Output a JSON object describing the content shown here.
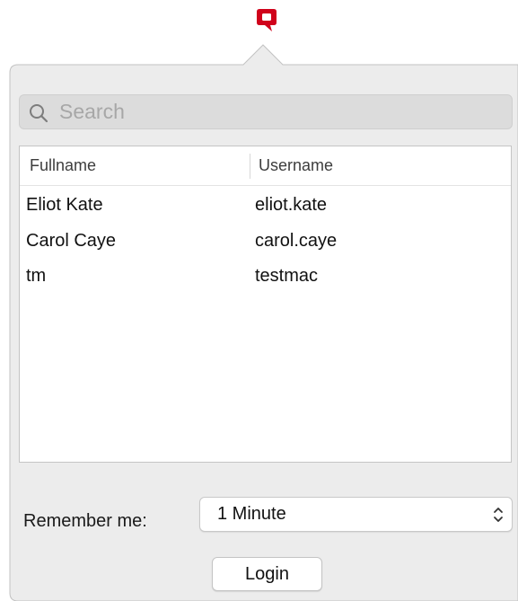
{
  "app": {
    "logo_icon": "red-speech-bubble-q-logo",
    "brand_color": "#d0021b"
  },
  "search": {
    "placeholder": "Search",
    "value": ""
  },
  "table": {
    "columns": [
      "Fullname",
      "Username"
    ],
    "rows": [
      {
        "fullname": "Eliot Kate",
        "username": "eliot.kate"
      },
      {
        "fullname": "Carol Caye",
        "username": "carol.caye"
      },
      {
        "fullname": "tm",
        "username": "testmac"
      }
    ]
  },
  "remember": {
    "label": "Remember me:",
    "selected": "1 Minute"
  },
  "login": {
    "label": "Login"
  }
}
